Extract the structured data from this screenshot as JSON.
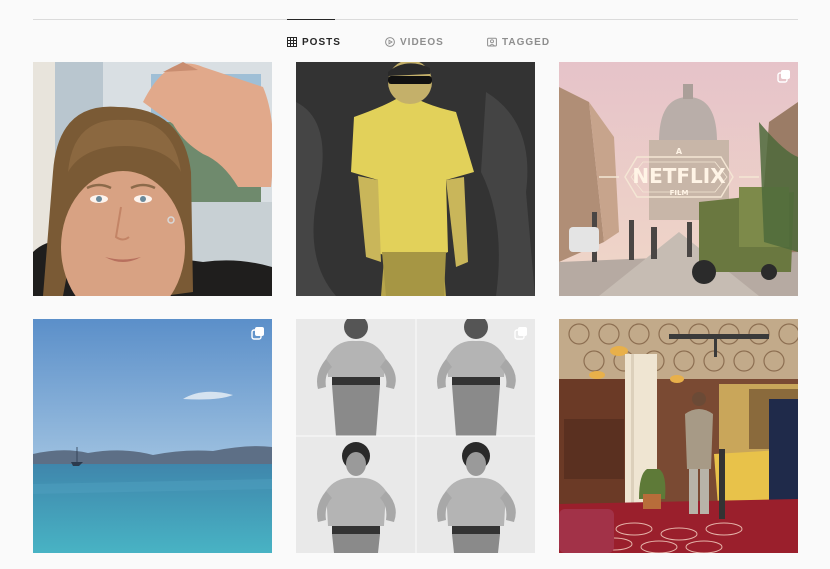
{
  "tabs": [
    {
      "label": "POSTS",
      "icon": "grid-icon",
      "active": true
    },
    {
      "label": "VIDEOS",
      "icon": "play-circle-icon",
      "active": false
    },
    {
      "label": "TAGGED",
      "icon": "tag-portrait-icon",
      "active": false
    }
  ],
  "posts": [
    {
      "kind": "selfie"
    },
    {
      "kind": "yellow-tshirt"
    },
    {
      "kind": "rome-street",
      "multiple": true,
      "overlay_text": {
        "top": "A",
        "main": "NETFLIX",
        "bottom": "FILM"
      }
    },
    {
      "kind": "sea",
      "multiple": true
    },
    {
      "kind": "bw-collage",
      "multiple": true
    },
    {
      "kind": "bar-interior"
    }
  ],
  "colors": {
    "background": "#fafafa",
    "divider": "#dbdbdb",
    "active_text": "#262626",
    "inactive_text": "#8e8e8e"
  }
}
